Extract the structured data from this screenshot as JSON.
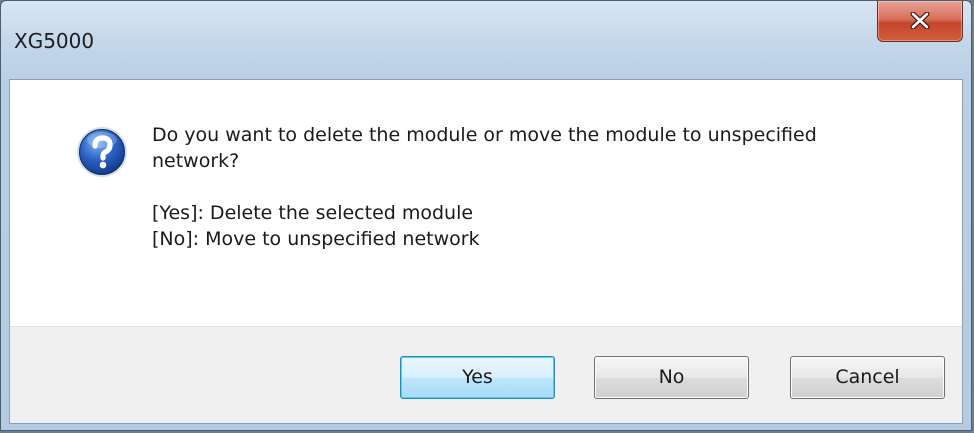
{
  "window": {
    "title": "XG5000",
    "close_label": "X"
  },
  "dialog": {
    "icon": "question-icon",
    "message_line1": "Do you want to delete the module or move the module to unspecified",
    "message_line2": "network?",
    "option_yes": "[Yes]: Delete the selected module",
    "option_no": "[No]: Move to unspecified network"
  },
  "buttons": {
    "yes": "Yes",
    "no": "No",
    "cancel": "Cancel"
  },
  "colors": {
    "titlebar": "#c4d7ea",
    "close_button": "#c5442c",
    "default_button_border": "#3c7fb1",
    "footer": "#f0f0f0"
  }
}
